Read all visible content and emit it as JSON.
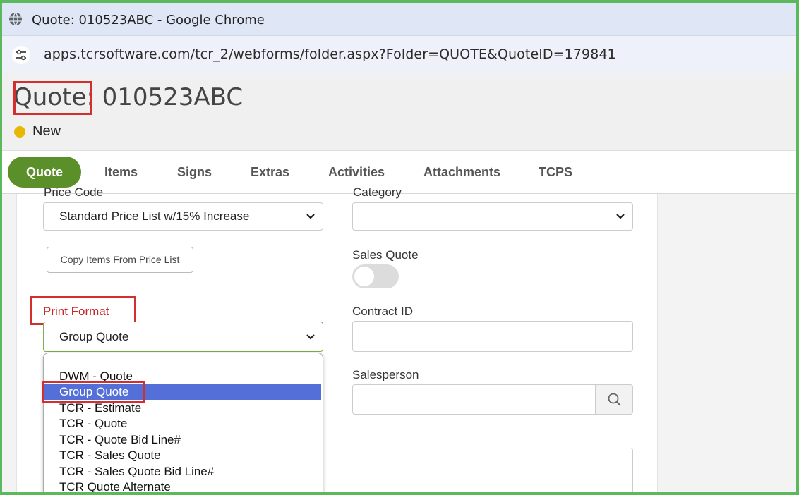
{
  "browser": {
    "window_title": "Quote: 010523ABC - Google Chrome",
    "url": "apps.tcrsoftware.com/tcr_2/webforms/folder.aspx?Folder=QUOTE&QuoteID=179841"
  },
  "header": {
    "title_label": "Quote:",
    "title_value": " 010523ABC",
    "status": "New",
    "status_color": "#e8b800"
  },
  "tabs": [
    {
      "label": "Quote",
      "active": true
    },
    {
      "label": "Items"
    },
    {
      "label": "Signs"
    },
    {
      "label": "Extras"
    },
    {
      "label": "Activities"
    },
    {
      "label": "Attachments"
    },
    {
      "label": "TCPS"
    }
  ],
  "form": {
    "price_code_label": "Price Code",
    "price_code_value": "Standard Price List w/15% Increase",
    "category_label": "Category",
    "category_value": "",
    "copy_items_button": "Copy Items From Price List",
    "sales_quote_label": "Sales Quote",
    "sales_quote_on": false,
    "print_format_label": "Print Format",
    "print_format_value": "Group Quote",
    "contract_id_label": "Contract ID",
    "salesperson_label": "Salesperson"
  },
  "print_format_options": [
    "DWM - Quote",
    "Group Quote",
    "TCR - Estimate",
    "TCR - Quote",
    "TCR - Quote Bid Line#",
    "TCR - Sales Quote",
    "TCR - Sales Quote Bid Line#",
    "TCR Quote Alternate"
  ],
  "colors": {
    "accent_green": "#5a8f2a",
    "highlight_red": "#d32f2f",
    "selection_blue": "#5470d8",
    "print_format_label": "#c62828",
    "frame_green": "#5cb85c"
  }
}
